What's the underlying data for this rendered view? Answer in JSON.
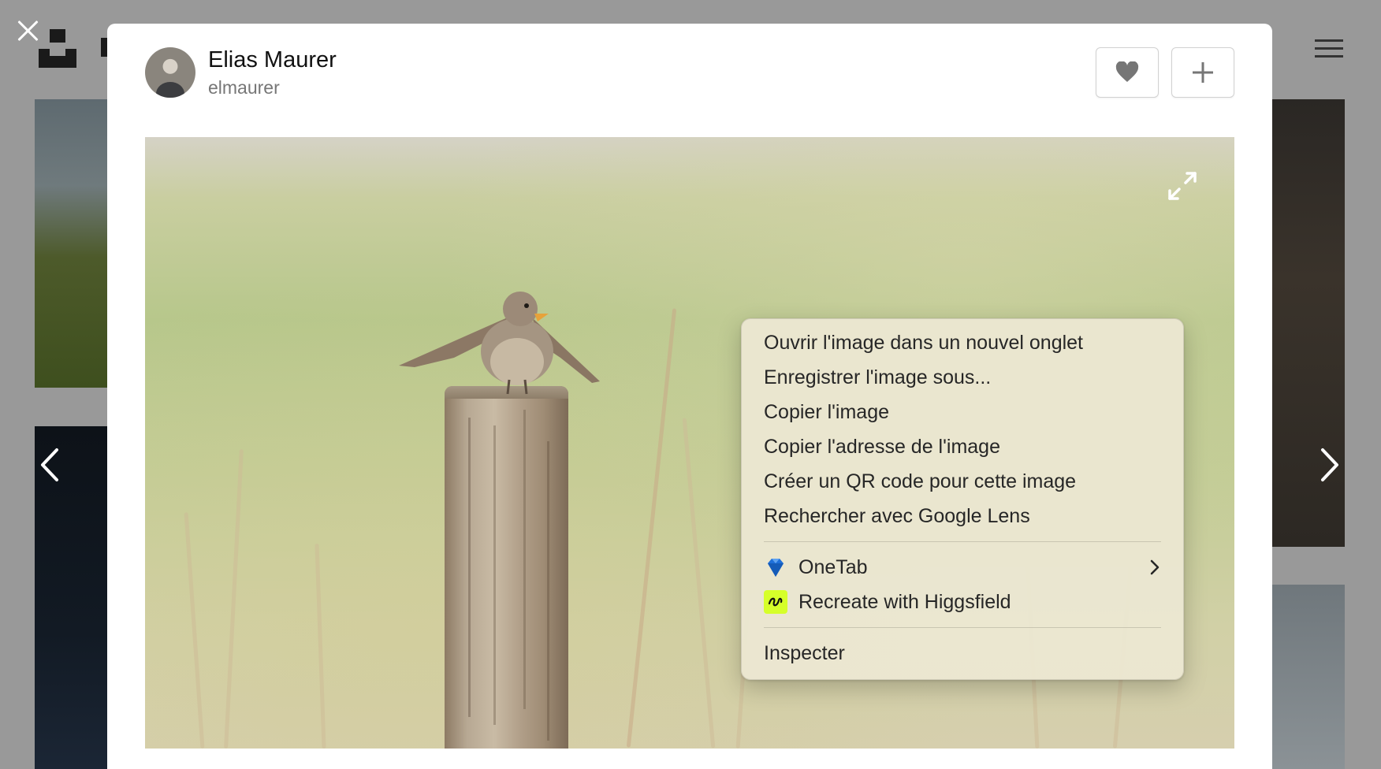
{
  "modal": {
    "author": {
      "name": "Elias Maurer",
      "handle": "elmaurer"
    }
  },
  "context_menu": {
    "items": [
      {
        "label": "Ouvrir l'image dans un nouvel onglet"
      },
      {
        "label": "Enregistrer l'image sous..."
      },
      {
        "label": "Copier l'image"
      },
      {
        "label": "Copier l'adresse de l'image"
      },
      {
        "label": "Créer un QR code pour cette image"
      },
      {
        "label": "Rechercher avec Google Lens"
      }
    ],
    "extensions": [
      {
        "label": "OneTab",
        "icon": "onetab-diamond-icon",
        "has_submenu": true
      },
      {
        "label": "Recreate with Higgsfield",
        "icon": "higgsfield-icon"
      }
    ],
    "dev": [
      {
        "label": "Inspecter"
      }
    ]
  },
  "colors": {
    "modal_bg": "#ffffff",
    "overlay": "#9a9a9a",
    "menu_bg": "#ece8d2",
    "higgsfield_accent": "#d6ff2a",
    "onetab_blue": "#1e6fd9"
  }
}
